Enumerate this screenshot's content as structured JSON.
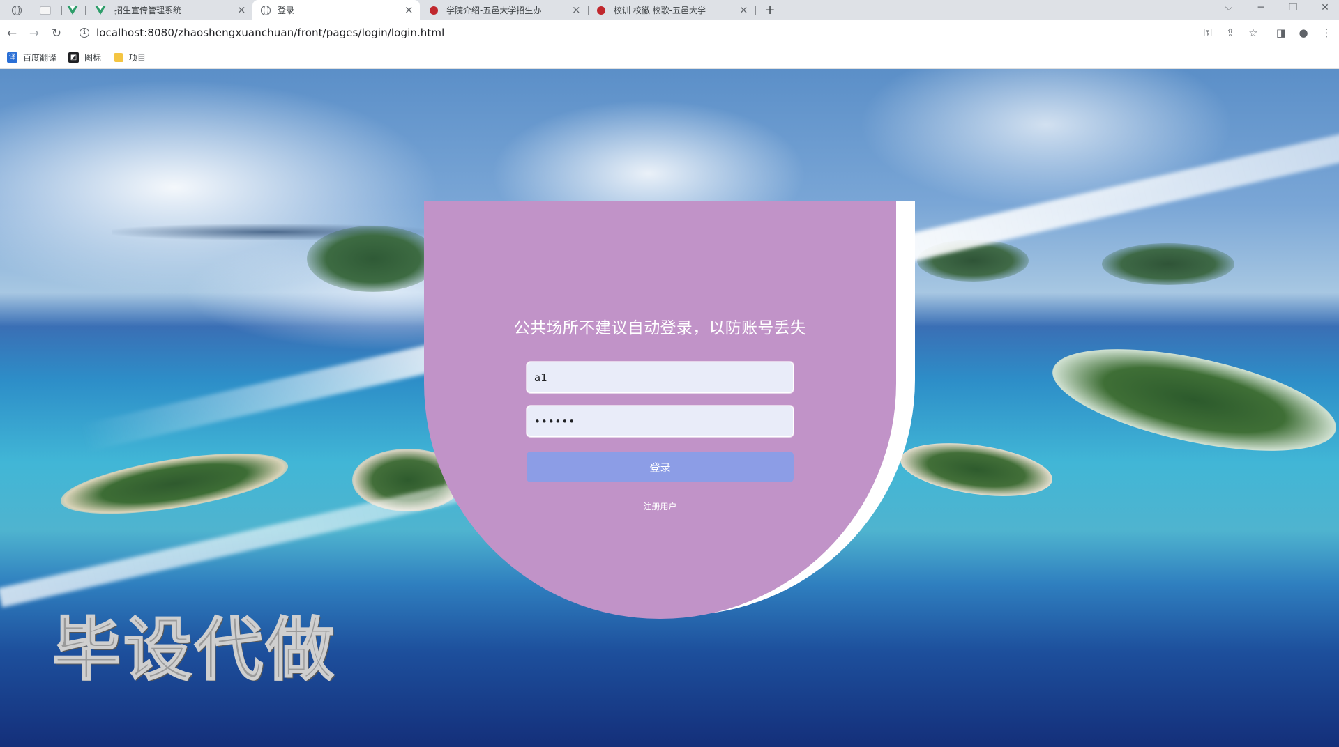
{
  "browser": {
    "tabs": [
      {
        "title": "招生宣传管理系统",
        "icon": "vue-icon"
      },
      {
        "title": "登录",
        "icon": "globe-icon"
      },
      {
        "title": "学院介绍-五邑大学招生办",
        "icon": "site-red-icon"
      },
      {
        "title": "校训 校徽 校歌-五邑大学",
        "icon": "site-red-icon"
      }
    ],
    "close_glyph": "×",
    "new_tab_glyph": "+",
    "window": {
      "minimize": "─",
      "restore": "❐",
      "close": "✕",
      "tab_search": "⌵"
    },
    "url": "localhost:8080/zhaoshengxuanchuan/front/pages/login/login.html"
  },
  "bookmarks": [
    {
      "label": "百度翻译",
      "icon": "translate-icon",
      "glyph": "译"
    },
    {
      "label": "图标",
      "icon": "image-icon",
      "glyph": "◩"
    },
    {
      "label": "项目",
      "icon": "folder-icon",
      "glyph": ""
    }
  ],
  "login": {
    "notice": "公共场所不建议自动登录，以防账号丢失",
    "username_value": "a1",
    "password_value": "••••••",
    "login_label": "登录",
    "register_label": "注册用户"
  },
  "watermark": "毕设代做",
  "colors": {
    "card": "#c193c8",
    "button": "#8c9de6",
    "input_bg": "#e9ecf9"
  }
}
